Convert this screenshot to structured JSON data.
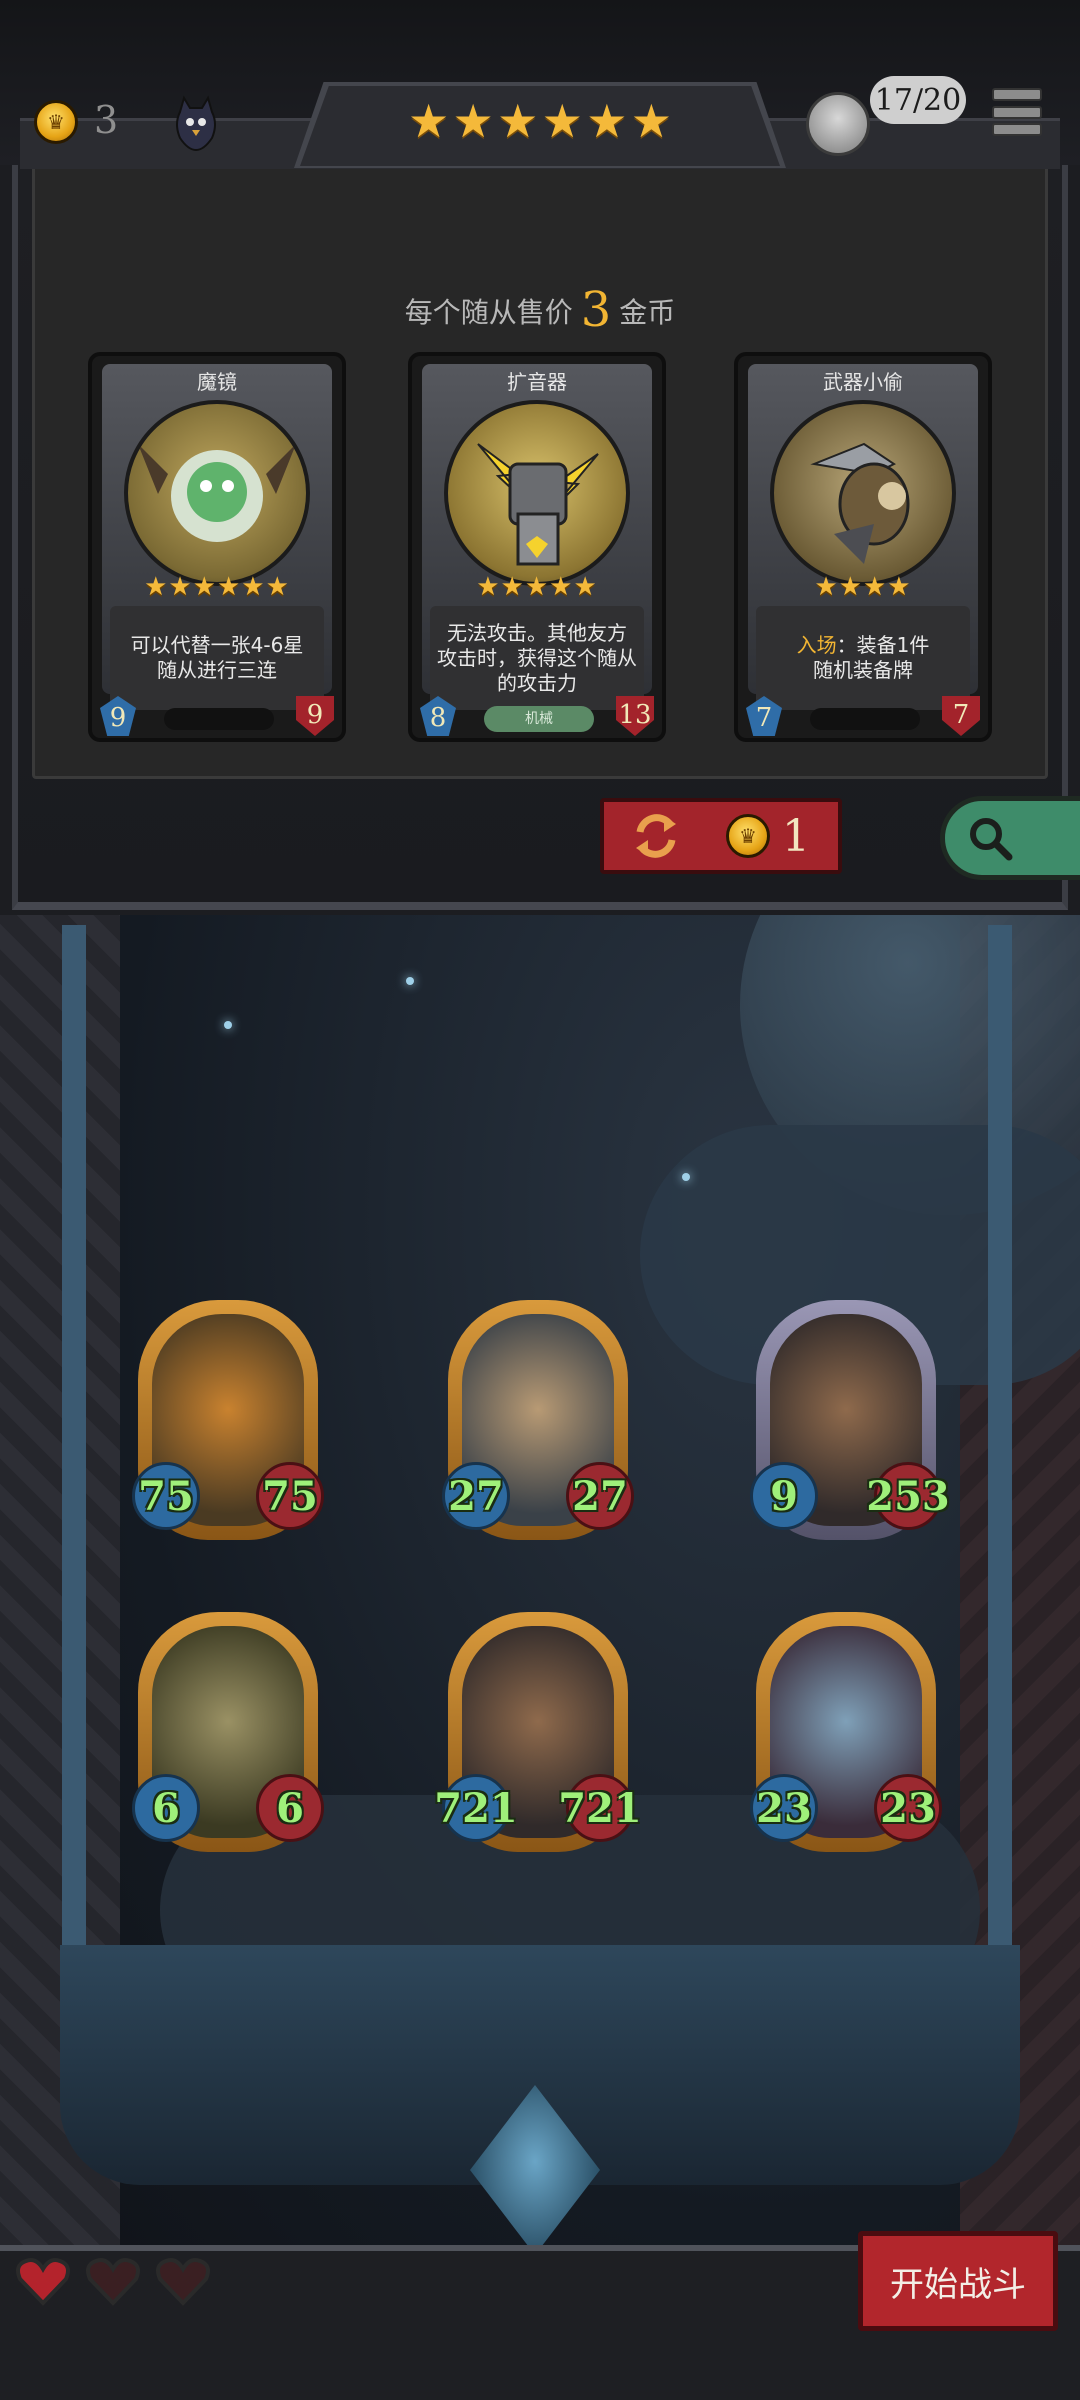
{
  "header": {
    "gold": "3",
    "tier_stars": 6,
    "board_count": "17/20",
    "colors": {
      "gold": "#f2b533",
      "star": "#f4b93a",
      "refresh": "#a3242b"
    }
  },
  "shop": {
    "price_prefix": "每个随从售价",
    "price_value": "3",
    "price_suffix": "金币",
    "cards": [
      {
        "name": "魔镜",
        "stars": "★★★★★★",
        "desc_lines": [
          "可以代替一张4-6星",
          "随从进行三连"
        ],
        "cost": "9",
        "health": "9",
        "tag": ""
      },
      {
        "name": "扩音器",
        "stars": "★★★★★",
        "desc_lines": [
          "无法攻击。其他友方",
          "攻击时，获得这个随从",
          "的攻击力"
        ],
        "cost": "8",
        "health": "13",
        "tag": "机械"
      },
      {
        "name": "武器小偷",
        "stars": "★★★★",
        "desc_keyword": "入场",
        "desc_lines": [
          "：装备1件",
          "随机装备牌"
        ],
        "cost": "7",
        "health": "7",
        "tag": ""
      }
    ],
    "refresh_cost": "1",
    "icons": [
      "coin-icon",
      "bird-icon",
      "refresh-icon",
      "search-icon",
      "menu-icon",
      "heart-icon"
    ]
  },
  "board": {
    "minions": [
      {
        "name": "pumpkin",
        "attack": "75",
        "health": "75",
        "frame": "gold"
      },
      {
        "name": "beast",
        "attack": "27",
        "health": "27",
        "frame": "gold"
      },
      {
        "name": "brute",
        "attack": "9",
        "health": "253",
        "frame": "silver"
      },
      {
        "name": "swamp",
        "attack": "6",
        "health": "6",
        "frame": "gold"
      },
      {
        "name": "brute-gold",
        "attack": "721",
        "health": "721",
        "frame": "gold"
      },
      {
        "name": "elf",
        "attack": "23",
        "health": "23",
        "frame": "gold"
      }
    ]
  },
  "footer": {
    "lives": 3,
    "lives_filled": 1,
    "start_label": "开始战斗"
  }
}
